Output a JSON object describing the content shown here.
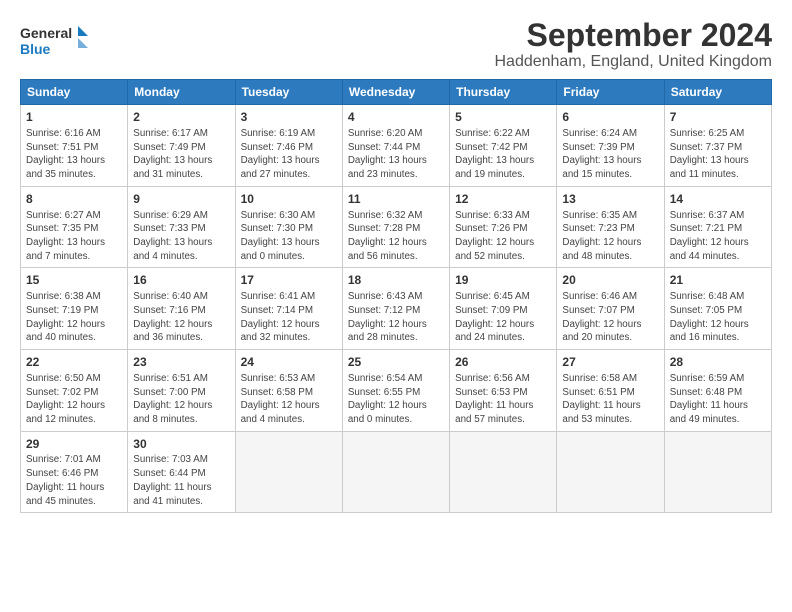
{
  "title": "September 2024",
  "subtitle": "Haddenham, England, United Kingdom",
  "logo": {
    "line1": "General",
    "line2": "Blue"
  },
  "days_of_week": [
    "Sunday",
    "Monday",
    "Tuesday",
    "Wednesday",
    "Thursday",
    "Friday",
    "Saturday"
  ],
  "weeks": [
    [
      {
        "day": "1",
        "info": "Sunrise: 6:16 AM\nSunset: 7:51 PM\nDaylight: 13 hours\nand 35 minutes."
      },
      {
        "day": "2",
        "info": "Sunrise: 6:17 AM\nSunset: 7:49 PM\nDaylight: 13 hours\nand 31 minutes."
      },
      {
        "day": "3",
        "info": "Sunrise: 6:19 AM\nSunset: 7:46 PM\nDaylight: 13 hours\nand 27 minutes."
      },
      {
        "day": "4",
        "info": "Sunrise: 6:20 AM\nSunset: 7:44 PM\nDaylight: 13 hours\nand 23 minutes."
      },
      {
        "day": "5",
        "info": "Sunrise: 6:22 AM\nSunset: 7:42 PM\nDaylight: 13 hours\nand 19 minutes."
      },
      {
        "day": "6",
        "info": "Sunrise: 6:24 AM\nSunset: 7:39 PM\nDaylight: 13 hours\nand 15 minutes."
      },
      {
        "day": "7",
        "info": "Sunrise: 6:25 AM\nSunset: 7:37 PM\nDaylight: 13 hours\nand 11 minutes."
      }
    ],
    [
      {
        "day": "8",
        "info": "Sunrise: 6:27 AM\nSunset: 7:35 PM\nDaylight: 13 hours\nand 7 minutes."
      },
      {
        "day": "9",
        "info": "Sunrise: 6:29 AM\nSunset: 7:33 PM\nDaylight: 13 hours\nand 4 minutes."
      },
      {
        "day": "10",
        "info": "Sunrise: 6:30 AM\nSunset: 7:30 PM\nDaylight: 13 hours\nand 0 minutes."
      },
      {
        "day": "11",
        "info": "Sunrise: 6:32 AM\nSunset: 7:28 PM\nDaylight: 12 hours\nand 56 minutes."
      },
      {
        "day": "12",
        "info": "Sunrise: 6:33 AM\nSunset: 7:26 PM\nDaylight: 12 hours\nand 52 minutes."
      },
      {
        "day": "13",
        "info": "Sunrise: 6:35 AM\nSunset: 7:23 PM\nDaylight: 12 hours\nand 48 minutes."
      },
      {
        "day": "14",
        "info": "Sunrise: 6:37 AM\nSunset: 7:21 PM\nDaylight: 12 hours\nand 44 minutes."
      }
    ],
    [
      {
        "day": "15",
        "info": "Sunrise: 6:38 AM\nSunset: 7:19 PM\nDaylight: 12 hours\nand 40 minutes."
      },
      {
        "day": "16",
        "info": "Sunrise: 6:40 AM\nSunset: 7:16 PM\nDaylight: 12 hours\nand 36 minutes."
      },
      {
        "day": "17",
        "info": "Sunrise: 6:41 AM\nSunset: 7:14 PM\nDaylight: 12 hours\nand 32 minutes."
      },
      {
        "day": "18",
        "info": "Sunrise: 6:43 AM\nSunset: 7:12 PM\nDaylight: 12 hours\nand 28 minutes."
      },
      {
        "day": "19",
        "info": "Sunrise: 6:45 AM\nSunset: 7:09 PM\nDaylight: 12 hours\nand 24 minutes."
      },
      {
        "day": "20",
        "info": "Sunrise: 6:46 AM\nSunset: 7:07 PM\nDaylight: 12 hours\nand 20 minutes."
      },
      {
        "day": "21",
        "info": "Sunrise: 6:48 AM\nSunset: 7:05 PM\nDaylight: 12 hours\nand 16 minutes."
      }
    ],
    [
      {
        "day": "22",
        "info": "Sunrise: 6:50 AM\nSunset: 7:02 PM\nDaylight: 12 hours\nand 12 minutes."
      },
      {
        "day": "23",
        "info": "Sunrise: 6:51 AM\nSunset: 7:00 PM\nDaylight: 12 hours\nand 8 minutes."
      },
      {
        "day": "24",
        "info": "Sunrise: 6:53 AM\nSunset: 6:58 PM\nDaylight: 12 hours\nand 4 minutes."
      },
      {
        "day": "25",
        "info": "Sunrise: 6:54 AM\nSunset: 6:55 PM\nDaylight: 12 hours\nand 0 minutes."
      },
      {
        "day": "26",
        "info": "Sunrise: 6:56 AM\nSunset: 6:53 PM\nDaylight: 11 hours\nand 57 minutes."
      },
      {
        "day": "27",
        "info": "Sunrise: 6:58 AM\nSunset: 6:51 PM\nDaylight: 11 hours\nand 53 minutes."
      },
      {
        "day": "28",
        "info": "Sunrise: 6:59 AM\nSunset: 6:48 PM\nDaylight: 11 hours\nand 49 minutes."
      }
    ],
    [
      {
        "day": "29",
        "info": "Sunrise: 7:01 AM\nSunset: 6:46 PM\nDaylight: 11 hours\nand 45 minutes."
      },
      {
        "day": "30",
        "info": "Sunrise: 7:03 AM\nSunset: 6:44 PM\nDaylight: 11 hours\nand 41 minutes."
      },
      {
        "day": "",
        "info": ""
      },
      {
        "day": "",
        "info": ""
      },
      {
        "day": "",
        "info": ""
      },
      {
        "day": "",
        "info": ""
      },
      {
        "day": "",
        "info": ""
      }
    ]
  ]
}
